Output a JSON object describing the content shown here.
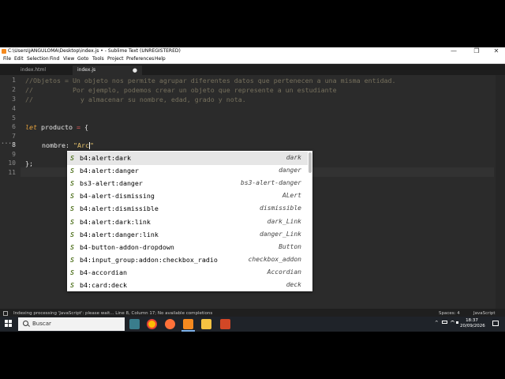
{
  "window": {
    "title": "C:\\Users\\JANGULOMA\\Desktop\\index.js • - Sublime Text (UNREGISTERED)",
    "controls": [
      "—",
      "❐",
      "✕"
    ]
  },
  "menu": [
    "File",
    "Edit",
    "Selection",
    "Find",
    "View",
    "Goto",
    "Tools",
    "Project",
    "Preferences",
    "Help"
  ],
  "tabs": [
    {
      "label": "index.html",
      "active": false,
      "close": ""
    },
    {
      "label": "index.js",
      "active": true,
      "close": "●"
    }
  ],
  "gutter": {
    "lines": [
      "1",
      "2",
      "3",
      "4",
      "5",
      "6",
      "7",
      "8",
      "9",
      "10",
      "11"
    ],
    "current_line": "8",
    "fold_marker": "• • •"
  },
  "code": {
    "line1": "//Objetos = Un objeto nos permite agrupar diferentes datos que pertenecen a una misma entidad.",
    "line2": "//          Por ejemplo, podemos crear un objeto que represente a un estudiante",
    "line3": "//            y almacenar su nombre, edad, grado y nota.",
    "line6_kw": "let",
    "line6_var": " producto ",
    "line6_op": "=",
    "line6_rest": " {",
    "line8_prop": "nombre",
    "line8_colon": ": ",
    "line8_str": "\"Arc\"",
    "line10": "};"
  },
  "autocomplete": {
    "items": [
      {
        "trigger": "b4:alert:dark",
        "hint": "dark",
        "selected": true
      },
      {
        "trigger": "b4:alert:danger",
        "hint": "danger",
        "selected": false
      },
      {
        "trigger": "bs3-alert:danger",
        "hint": "bs3-alert-danger",
        "selected": false
      },
      {
        "trigger": "b4-alert-dismissing",
        "hint": "ALert",
        "selected": false
      },
      {
        "trigger": "b4:alert:dismissible",
        "hint": "dismissible",
        "selected": false
      },
      {
        "trigger": "b4:alert:dark:link",
        "hint": "dark_Link",
        "selected": false
      },
      {
        "trigger": "b4:alert:danger:link",
        "hint": "danger_Link",
        "selected": false
      },
      {
        "trigger": "b4-button-addon-dropdown",
        "hint": "Button",
        "selected": false
      },
      {
        "trigger": "b4:input_group:addon:checkbox_radio",
        "hint": "checkbox_addon",
        "selected": false
      },
      {
        "trigger": "b4-accordian",
        "hint": "Accordian",
        "selected": false
      },
      {
        "trigger": "b4:card:deck",
        "hint": "deck",
        "selected": false
      }
    ],
    "kind_letter": "S"
  },
  "status": {
    "message": "Indexing processing 'JavaScript': please wait... Line 8, Column 17; No available completions",
    "spaces": "Spaces: 4",
    "syntax": "JavaScript"
  },
  "taskbar": {
    "search_label": "Buscar",
    "time": "18:37",
    "date": "20/09/2026",
    "icons": [
      "task-view-icon",
      "chrome-icon",
      "firefox-icon",
      "sublime-text-icon",
      "file-explorer-icon",
      "powerpoint-icon"
    ],
    "tray": [
      "^",
      "🔋",
      "📶",
      "🔊"
    ]
  },
  "colors": {
    "editor_bg": "#2b2b2b",
    "comment": "#76705d",
    "keyword": "#e6a23c",
    "operator": "#e05a5a",
    "string": "#e8c46c",
    "popup_bg": "#ffffff",
    "snippet_letter": "#5a7a2c"
  }
}
